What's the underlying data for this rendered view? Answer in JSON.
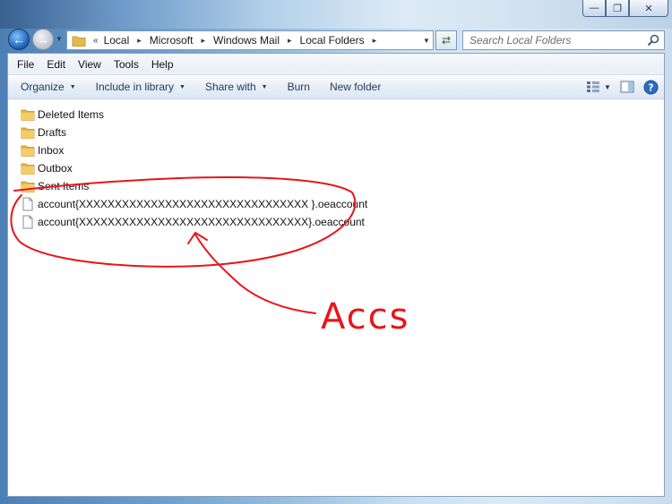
{
  "window": {
    "caption_buttons": [
      {
        "name": "minimize",
        "glyph": "—"
      },
      {
        "name": "maximize",
        "glyph": "❐"
      },
      {
        "name": "close",
        "glyph": "✕"
      }
    ]
  },
  "address": {
    "overflow": "«",
    "crumbs": [
      "Local",
      "Microsoft",
      "Windows Mail",
      "Local Folders"
    ],
    "separator": "▸"
  },
  "search": {
    "placeholder": "Search Local Folders"
  },
  "menubar": [
    "File",
    "Edit",
    "View",
    "Tools",
    "Help"
  ],
  "toolbar": {
    "organize": "Organize",
    "include_in_library": "Include in library",
    "share_with": "Share with",
    "burn": "Burn",
    "new_folder": "New folder"
  },
  "files": [
    {
      "name": "Deleted Items",
      "type": "folder"
    },
    {
      "name": "Drafts",
      "type": "folder"
    },
    {
      "name": "Inbox",
      "type": "folder"
    },
    {
      "name": "Outbox",
      "type": "folder"
    },
    {
      "name": "Sent Items",
      "type": "folder"
    },
    {
      "name": "account{XXXXXXXXXXXXXXXXXXXXXXXXXXXXXXXX }.oeaccount",
      "type": "file"
    },
    {
      "name": "account{XXXXXXXXXXXXXXXXXXXXXXXXXXXXXXXX}.oeaccount",
      "type": "file"
    }
  ],
  "annotation": {
    "text": "Accs",
    "color": "#e8141b"
  },
  "colors": {
    "accent": "#1e395b",
    "folder": "#e8b84a"
  }
}
